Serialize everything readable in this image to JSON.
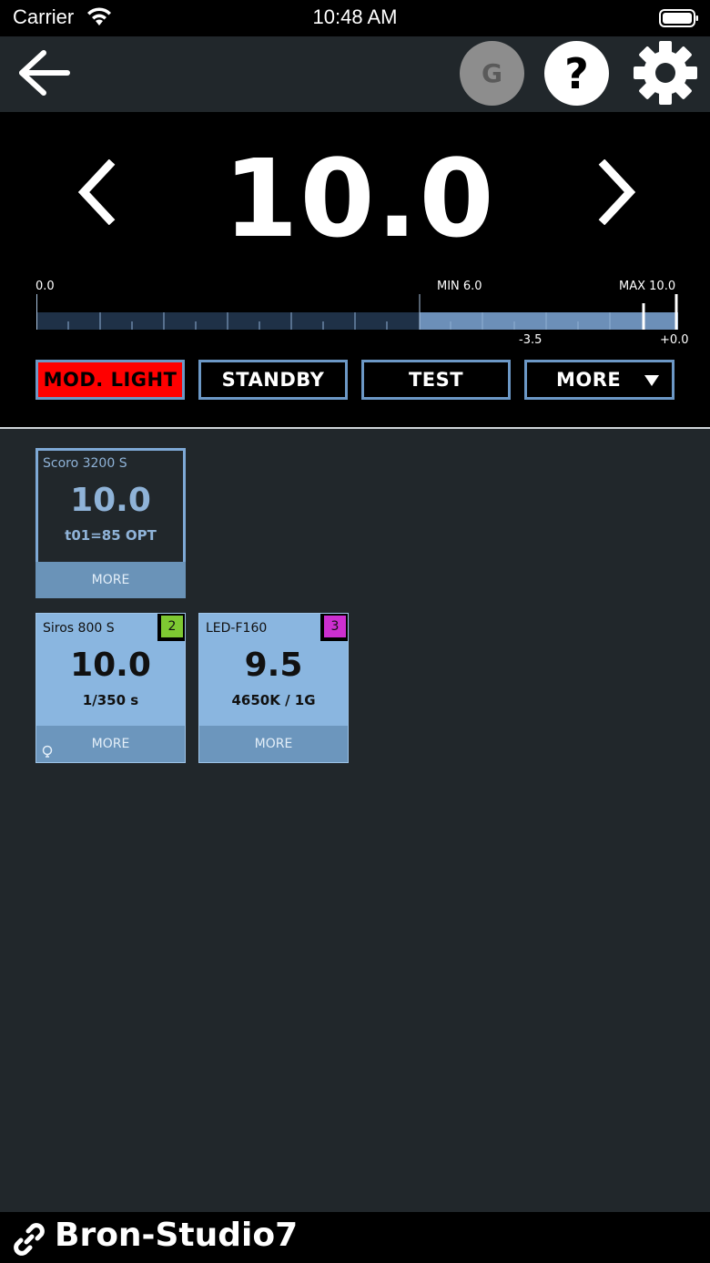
{
  "status_bar": {
    "carrier": "Carrier",
    "time": "10:48 AM"
  },
  "appbar": {
    "group_label": "G",
    "help_label": "?"
  },
  "panel": {
    "value": "10.0",
    "scale_min": "0.0",
    "range_min": "MIN 6.0",
    "range_max": "MAX 10.0",
    "offset_low": "-3.5",
    "offset_high": "+0.0",
    "buttons": {
      "mod_light": "MOD. LIGHT",
      "standby": "STANDBY",
      "test": "TEST",
      "more": "MORE"
    }
  },
  "devices": [
    {
      "name": "Scoro 3200 S",
      "value": "10.0",
      "sub": "t01=85 OPT",
      "more": "MORE"
    },
    {
      "name": "Siros 800 S",
      "value": "10.0",
      "sub": "1/350 s",
      "more": "MORE",
      "badge": "2",
      "badge_color": "#7ec832"
    },
    {
      "name": "LED-F160",
      "value": "9.5",
      "sub": "4650K / 1G",
      "more": "MORE",
      "badge": "3",
      "badge_color": "#cc2fd0"
    }
  ],
  "bottom": {
    "studio": "Bron-Studio7"
  },
  "colors": {
    "accent": "#6c98c6",
    "mod_light_active": "#ff0000",
    "card_bg": "#8ab6e0",
    "background": "#21272b"
  }
}
